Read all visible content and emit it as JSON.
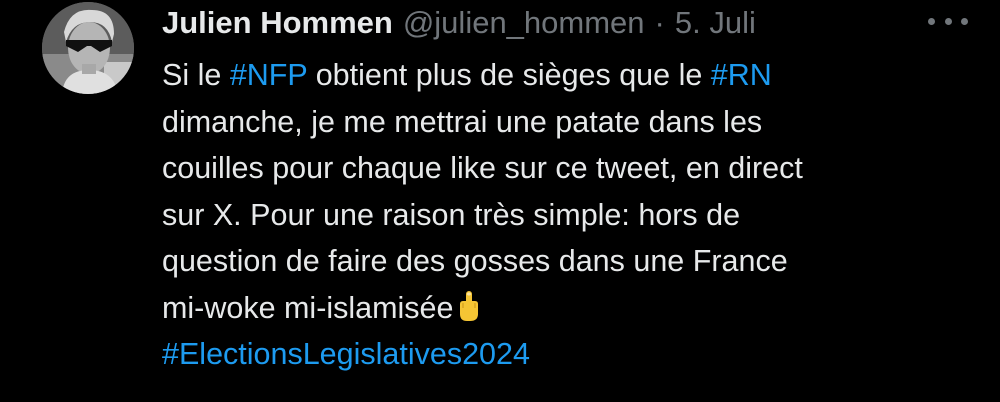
{
  "author": {
    "display_name": "Julien Hommen",
    "handle": "@julien_hommen",
    "separator": "·",
    "date": "5. Juli"
  },
  "more_icon": "more-horizontal-icon",
  "tweet": {
    "line1": {
      "t1": "Si le ",
      "tag1": "#NFP",
      "t2": " obtient plus de sièges que le ",
      "tag2": "#RN"
    },
    "line2": "dimanche, je me mettrai une patate dans les",
    "line3": "couilles pour chaque like sur ce tweet, en direct",
    "line4": "sur X. Pour une raison très simple: hors de",
    "line5": "question de faire des gosses dans une France",
    "line6": "mi-woke mi-islamisée",
    "emoji": "middle-finger-emoji-icon",
    "line7_tag": "#ElectionsLegislatives2024"
  },
  "colors": {
    "background": "#000000",
    "text": "#e7e9ea",
    "secondary": "#71767b",
    "link": "#1d9bf0",
    "emoji": "#f5c534"
  }
}
